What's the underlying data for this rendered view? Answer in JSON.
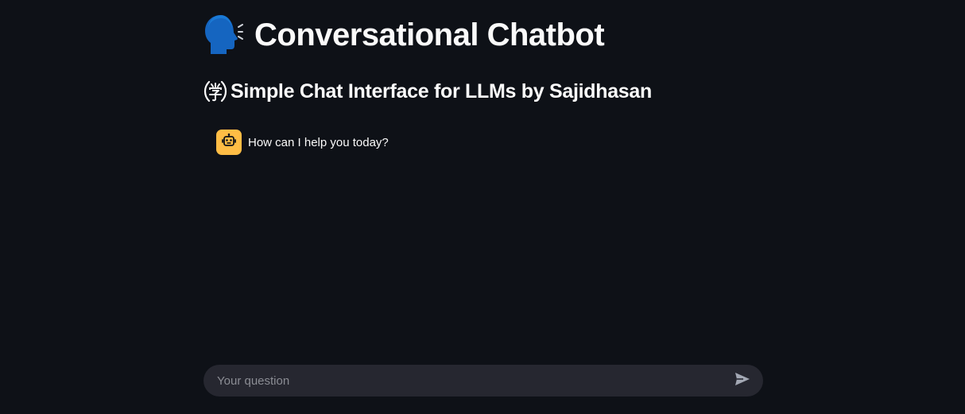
{
  "header": {
    "title": "Conversational Chatbot",
    "title_icon": "speaking-head-icon",
    "subtitle": "Simple Chat Interface for LLMs by Sajidhasan",
    "subtitle_icon": "circled-ideograph-study-icon"
  },
  "messages": [
    {
      "role": "assistant",
      "avatar_icon": "robot-icon",
      "text": "How can I help you today?"
    }
  ],
  "chat_input": {
    "placeholder": "Your question",
    "value": "",
    "send_icon": "send-icon"
  },
  "colors": {
    "background": "#0e1117",
    "text": "#fafafa",
    "avatar_bg": "#ffbd45",
    "input_bg": "#262730",
    "placeholder": "#8b8d94"
  }
}
